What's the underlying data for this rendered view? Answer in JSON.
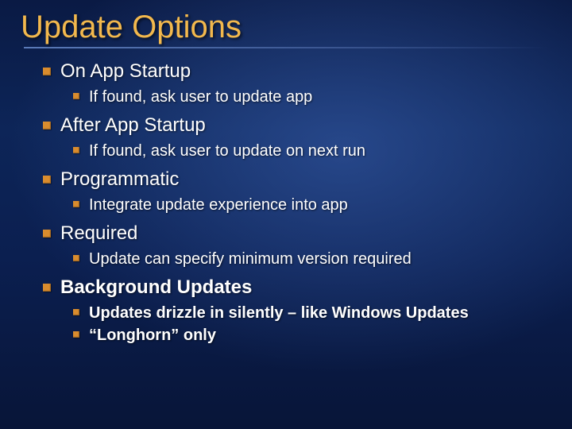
{
  "title": "Update Options",
  "bullets": [
    {
      "text": "On App Startup",
      "bold": false,
      "sub": [
        {
          "text": "If found, ask user to update app",
          "bold": false
        }
      ]
    },
    {
      "text": "After App Startup",
      "bold": false,
      "sub": [
        {
          "text": "If found, ask user to update on next run",
          "bold": false
        }
      ]
    },
    {
      "text": "Programmatic",
      "bold": false,
      "sub": [
        {
          "text": "Integrate update experience into app",
          "bold": false
        }
      ]
    },
    {
      "text": "Required",
      "bold": false,
      "sub": [
        {
          "text": "Update can specify minimum version required",
          "bold": false
        }
      ]
    },
    {
      "text": "Background Updates",
      "bold": true,
      "sub": [
        {
          "text": "Updates drizzle in silently – like Windows Updates",
          "bold": true
        },
        {
          "text": "“Longhorn” only",
          "bold": true
        }
      ]
    }
  ]
}
